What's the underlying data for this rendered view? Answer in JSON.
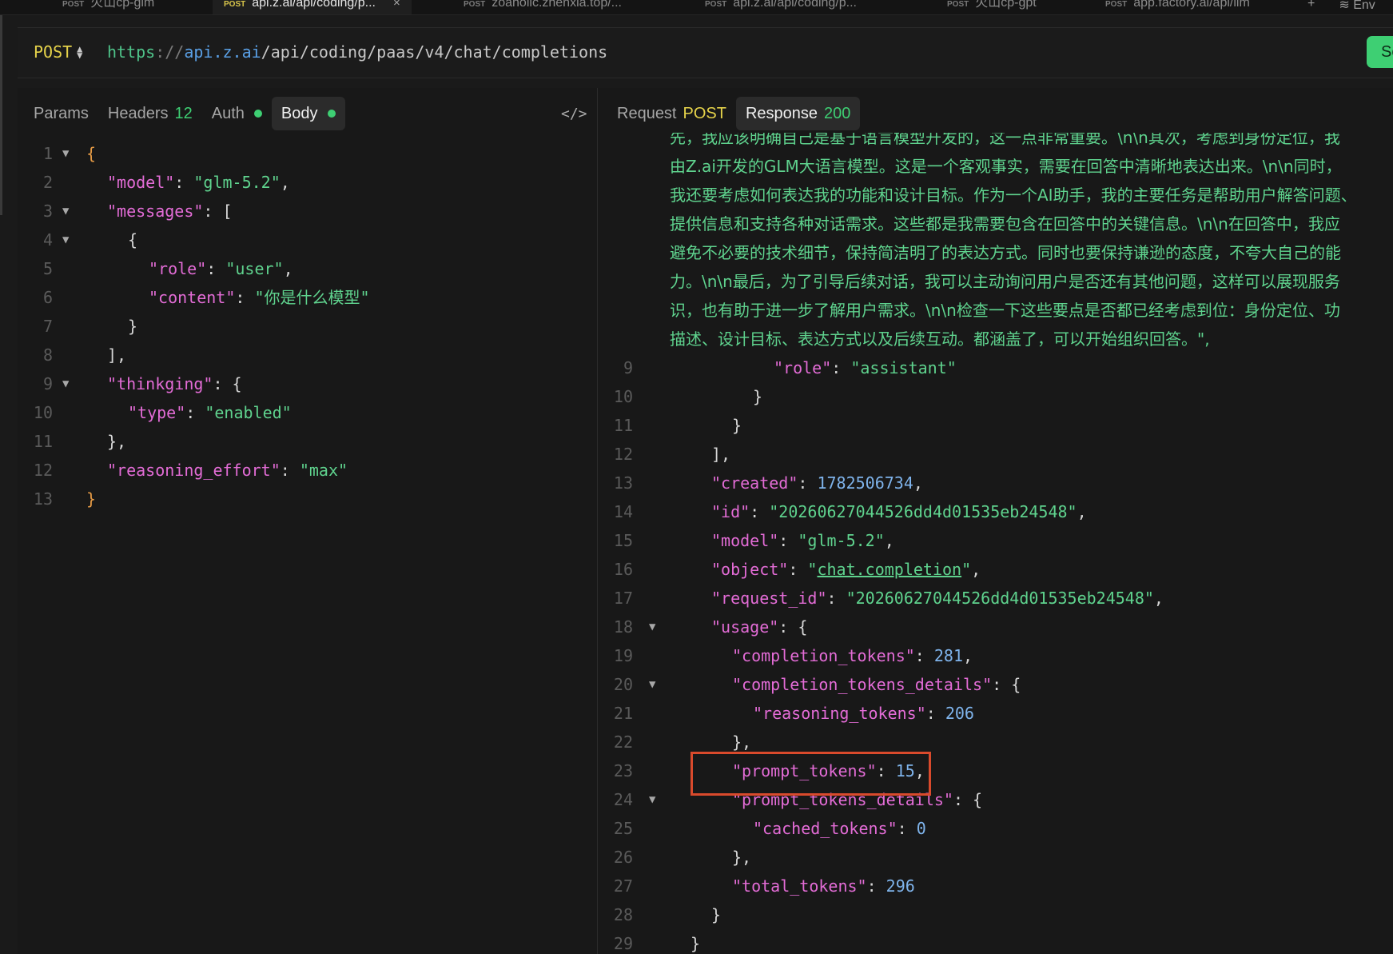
{
  "tabs": [
    {
      "method": "POST",
      "label": "火山cp-glm",
      "active": false
    },
    {
      "method": "POST",
      "label": "api.z.ai/api/coding/p...",
      "active": true,
      "close": "×"
    },
    {
      "method": "POST",
      "label": "zoaholic.zhenxia.top/...",
      "active": false
    },
    {
      "method": "POST",
      "label": "api.z.ai/api/coding/p...",
      "active": false
    },
    {
      "method": "POST",
      "label": "火山cp-gpt",
      "active": false
    },
    {
      "method": "POST",
      "label": "app.factory.ai/api/llm",
      "active": false
    }
  ],
  "tab_actions": {
    "more": "+",
    "env": "Env"
  },
  "request": {
    "method": "POST",
    "url_scheme": "https",
    "url_sep": "://",
    "url_host": "api.z.ai",
    "url_path": "/api/coding/paas/v4/chat/completions",
    "send_label": "Send"
  },
  "left_tabs": {
    "params": "Params",
    "headers": "Headers",
    "headers_count": "12",
    "auth": "Auth",
    "body": "Body",
    "code_icon": "</>"
  },
  "right_tabs": {
    "request": "Request",
    "request_method": "POST",
    "response": "Response",
    "status": "200"
  },
  "body_lines": [
    {
      "n": "1",
      "fold": "▼",
      "indent": 0,
      "parts": [
        [
          "b",
          "{"
        ]
      ]
    },
    {
      "n": "2",
      "fold": "",
      "indent": 1,
      "parts": [
        [
          "k",
          "\"model\""
        ],
        [
          "p",
          ": "
        ],
        [
          "s",
          "\"glm-5.2\""
        ],
        [
          "p",
          ","
        ]
      ]
    },
    {
      "n": "3",
      "fold": "▼",
      "indent": 1,
      "parts": [
        [
          "k",
          "\"messages\""
        ],
        [
          "p",
          ": ["
        ]
      ]
    },
    {
      "n": "4",
      "fold": "▼",
      "indent": 2,
      "parts": [
        [
          "p",
          "{"
        ]
      ]
    },
    {
      "n": "5",
      "fold": "",
      "indent": 3,
      "parts": [
        [
          "k",
          "\"role\""
        ],
        [
          "p",
          ": "
        ],
        [
          "s",
          "\"user\""
        ],
        [
          "p",
          ","
        ]
      ]
    },
    {
      "n": "6",
      "fold": "",
      "indent": 3,
      "parts": [
        [
          "k",
          "\"content\""
        ],
        [
          "p",
          ": "
        ],
        [
          "s",
          "\"你是什么模型\""
        ]
      ]
    },
    {
      "n": "7",
      "fold": "",
      "indent": 2,
      "parts": [
        [
          "p",
          "}"
        ]
      ]
    },
    {
      "n": "8",
      "fold": "",
      "indent": 1,
      "parts": [
        [
          "p",
          "],"
        ]
      ]
    },
    {
      "n": "9",
      "fold": "▼",
      "indent": 1,
      "parts": [
        [
          "k",
          "\"thinkging\""
        ],
        [
          "p",
          ": {"
        ]
      ]
    },
    {
      "n": "10",
      "fold": "",
      "indent": 2,
      "parts": [
        [
          "k",
          "\"type\""
        ],
        [
          "p",
          ": "
        ],
        [
          "s",
          "\"enabled\""
        ]
      ]
    },
    {
      "n": "11",
      "fold": "",
      "indent": 1,
      "parts": [
        [
          "p",
          "},"
        ]
      ]
    },
    {
      "n": "12",
      "fold": "",
      "indent": 1,
      "parts": [
        [
          "k",
          "\"reasoning_effort\""
        ],
        [
          "p",
          ": "
        ],
        [
          "s",
          "\"max\""
        ]
      ]
    },
    {
      "n": "13",
      "fold": "",
      "indent": 0,
      "parts": [
        [
          "b",
          "}"
        ]
      ]
    }
  ],
  "response_wrapped": [
    "先，我应该明确自己是基于语言模型开发的，这一点非常重要。\\n\\n其次，考虑到身份定位，我",
    "由Z.ai开发的GLM大语言模型。这是一个客观事实，需要在回答中清晰地表达出来。\\n\\n同时，",
    "我还要考虑如何表达我的功能和设计目标。作为一个AI助手，我的主要任务是帮助用户解答问题、",
    "提供信息和支持各种对话需求。这些都是我需要包含在回答中的关键信息。\\n\\n在回答中，我应",
    "避免不必要的技术细节，保持简洁明了的表达方式。同时也要保持谦逊的态度，不夸大自己的能",
    "力。\\n\\n最后，为了引导后续对话，我可以主动询问用户是否还有其他问题，这样可以展现服务",
    "识，也有助于进一步了解用户需求。\\n\\n检查一下这些要点是否都已经考虑到位：身份定位、功",
    "描述、设计目标、表达方式以及后续互动。都涵盖了，可以开始组织回答。\","
  ],
  "response_lines": [
    {
      "n": "9",
      "fold": "",
      "indent": 4,
      "parts": [
        [
          "k",
          "\"role\""
        ],
        [
          "p",
          ": "
        ],
        [
          "s",
          "\"assistant\""
        ]
      ]
    },
    {
      "n": "10",
      "fold": "",
      "indent": 3,
      "parts": [
        [
          "p",
          "}"
        ]
      ]
    },
    {
      "n": "11",
      "fold": "",
      "indent": 2,
      "parts": [
        [
          "p",
          "}"
        ]
      ]
    },
    {
      "n": "12",
      "fold": "",
      "indent": 1,
      "parts": [
        [
          "p",
          "],"
        ]
      ]
    },
    {
      "n": "13",
      "fold": "",
      "indent": 1,
      "parts": [
        [
          "k",
          "\"created\""
        ],
        [
          "p",
          ": "
        ],
        [
          "n",
          "1782506734"
        ],
        [
          "p",
          ","
        ]
      ]
    },
    {
      "n": "14",
      "fold": "",
      "indent": 1,
      "parts": [
        [
          "k",
          "\"id\""
        ],
        [
          "p",
          ": "
        ],
        [
          "s",
          "\"20260627044526dd4d01535eb24548\""
        ],
        [
          "p",
          ","
        ]
      ]
    },
    {
      "n": "15",
      "fold": "",
      "indent": 1,
      "parts": [
        [
          "k",
          "\"model\""
        ],
        [
          "p",
          ": "
        ],
        [
          "s",
          "\"glm-5.2\""
        ],
        [
          "p",
          ","
        ]
      ]
    },
    {
      "n": "16",
      "fold": "",
      "indent": 1,
      "parts": [
        [
          "k",
          "\"object\""
        ],
        [
          "p",
          ": "
        ],
        [
          "s",
          "\""
        ],
        [
          "sl",
          "chat.completion"
        ],
        [
          "s",
          "\""
        ],
        [
          "p",
          ","
        ]
      ]
    },
    {
      "n": "17",
      "fold": "",
      "indent": 1,
      "parts": [
        [
          "k",
          "\"request_id\""
        ],
        [
          "p",
          ": "
        ],
        [
          "s",
          "\"20260627044526dd4d01535eb24548\""
        ],
        [
          "p",
          ","
        ]
      ]
    },
    {
      "n": "18",
      "fold": "▼",
      "indent": 1,
      "parts": [
        [
          "k",
          "\"usage\""
        ],
        [
          "p",
          ": {"
        ]
      ]
    },
    {
      "n": "19",
      "fold": "",
      "indent": 2,
      "parts": [
        [
          "k",
          "\"completion_tokens\""
        ],
        [
          "p",
          ": "
        ],
        [
          "n",
          "281"
        ],
        [
          "p",
          ","
        ]
      ]
    },
    {
      "n": "20",
      "fold": "▼",
      "indent": 2,
      "parts": [
        [
          "k",
          "\"completion_tokens_details\""
        ],
        [
          "p",
          ": {"
        ]
      ]
    },
    {
      "n": "21",
      "fold": "",
      "indent": 3,
      "parts": [
        [
          "k",
          "\"reasoning_tokens\""
        ],
        [
          "p",
          ": "
        ],
        [
          "n",
          "206"
        ]
      ]
    },
    {
      "n": "22",
      "fold": "",
      "indent": 2,
      "parts": [
        [
          "p",
          "},"
        ]
      ]
    },
    {
      "n": "23",
      "fold": "",
      "indent": 2,
      "parts": [
        [
          "k",
          "\"prompt_tokens\""
        ],
        [
          "p",
          ": "
        ],
        [
          "n",
          "15"
        ],
        [
          "p",
          ","
        ]
      ]
    },
    {
      "n": "24",
      "fold": "▼",
      "indent": 2,
      "parts": [
        [
          "k",
          "\"prompt_tokens_details\""
        ],
        [
          "p",
          ": {"
        ]
      ]
    },
    {
      "n": "25",
      "fold": "",
      "indent": 3,
      "parts": [
        [
          "k",
          "\"cached_tokens\""
        ],
        [
          "p",
          ": "
        ],
        [
          "n",
          "0"
        ]
      ]
    },
    {
      "n": "26",
      "fold": "",
      "indent": 2,
      "parts": [
        [
          "p",
          "},"
        ]
      ]
    },
    {
      "n": "27",
      "fold": "",
      "indent": 2,
      "parts": [
        [
          "k",
          "\"total_tokens\""
        ],
        [
          "p",
          ": "
        ],
        [
          "n",
          "296"
        ]
      ]
    },
    {
      "n": "28",
      "fold": "",
      "indent": 1,
      "parts": [
        [
          "p",
          "}"
        ]
      ]
    },
    {
      "n": "29",
      "fold": "",
      "indent": 0,
      "parts": [
        [
          "p",
          "}"
        ]
      ]
    }
  ],
  "colors": {
    "accent": "#3ecf73",
    "method": "#e5d24a",
    "key": "#e36cd6",
    "string": "#5fd38e",
    "number": "#7fb4ec",
    "highlight": "#d94a2c"
  }
}
